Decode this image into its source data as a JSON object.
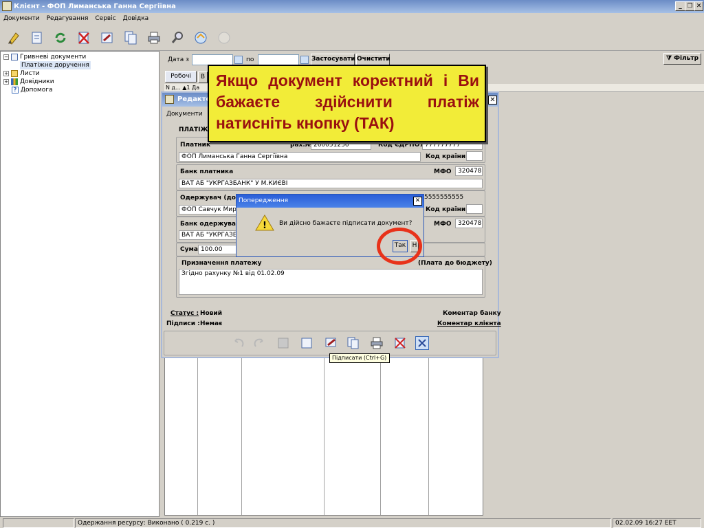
{
  "window": {
    "title": "Клієнт - ФОП Лиманська Ганна Сергіївна",
    "min": "_",
    "restore": "❐",
    "close": "✕"
  },
  "menu": [
    "Документи",
    "Редагування",
    "Сервіс",
    "Довідка"
  ],
  "tree": {
    "items": [
      {
        "label": "Гривневі документи",
        "expander": "⊟"
      },
      {
        "label": "Платіжне доручення",
        "expander": ""
      },
      {
        "label": "Листи",
        "expander": "⊞"
      },
      {
        "label": "Довідники",
        "expander": "⊞"
      },
      {
        "label": "Допомога",
        "expander": ""
      }
    ]
  },
  "filter": {
    "date_from_label": "Дата з",
    "date_to_label": "по",
    "apply_label": "Застосувати",
    "clear_label": "Очистити",
    "filter_label": "Фільтр"
  },
  "tabs": {
    "active": "Робочі",
    "second": "В"
  },
  "grid_header_fragment": "N д... ▲1 Да",
  "editor": {
    "title": "Редакто",
    "menu": "Документи",
    "doc_type": "ПЛАТІЖН",
    "payer_label": "Платник",
    "account_label": "рах.№",
    "account_value": "260051236",
    "edrpou_label": "Код ЄДРПОУ",
    "edrpou_value": "777777777",
    "payer_name": "ФОП Лиманська Ганна Сергіївна",
    "country_label": "Код країни",
    "payer_bank_label": "Банк платника",
    "mfo_label": "МФО",
    "mfo_value": "320478",
    "payer_bank_name": "ВАТ АБ \"УКРГАЗБАНК\" У М.КИЄВІ",
    "recipient_label": "Одержувач  (дод",
    "recipient_edrpou_value": "5555555555",
    "recipient_name": "ФОП Савчук Миро",
    "recipient_bank_label": "Банк одержувача",
    "recipient_bank_name": "ВАТ АБ \"УКРГАЗБ",
    "recipient_mfo_value": "320478",
    "sum_label": "Сума",
    "sum_value": "100.00",
    "purpose_label": "Призначення платежу",
    "budget_label": "(Плата до бюджету)",
    "purpose_value": "Згідно рахунку №1 від 01.02.09",
    "status_label": "Статус :",
    "status_value": "Новий",
    "signatures_label": "Підписи :",
    "signatures_value": "Немає",
    "bank_comment_label": "Коментар банку",
    "client_comment_label": "Коментар клієнта"
  },
  "dialog": {
    "title": "Попередження",
    "close": "✕",
    "message": "Ви дійсно бажаєте підписати документ?",
    "yes_label": "Так",
    "no_label": "Н"
  },
  "callout": {
    "text": "Якщо документ коректний і Ви бажаєте здійснити платіж натисніть кнопку (ТАК)"
  },
  "tooltip": {
    "text": "Підписати (Ctrl+G)"
  },
  "status": {
    "message": "Одержання ресурсу: Виконано ( 0.219 с. )",
    "datetime": "02.02.09 16:27 EET"
  },
  "colors": {
    "title_blue": "#6b8cc6",
    "callout_bg": "#f2ec38",
    "callout_text": "#9a1010",
    "highlight_circle": "#e8321a",
    "dialog_blue": "#2a5ed8"
  }
}
